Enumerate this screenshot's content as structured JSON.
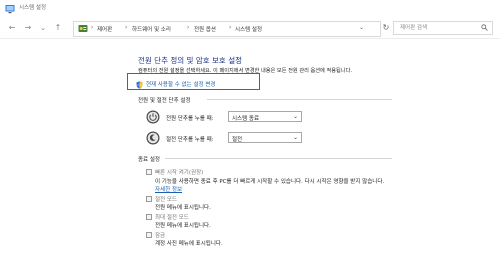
{
  "window": {
    "title": "시스템 설정"
  },
  "nav": {
    "back": "←",
    "forward": "→",
    "dropdown": "⌄",
    "up": "↑",
    "breadcrumb": [
      "제어판",
      "하드웨어 및 소리",
      "전원 옵션",
      "시스템 설정"
    ],
    "separator": "›",
    "refresh": "↻",
    "search_placeholder": "제어판 검색"
  },
  "main": {
    "heading": "전원 단추 정의 및 암호 보호 설정",
    "description": "컴퓨터의 전원 설정을 선택하세요. 이 페이지에서 변경한 내용은 모든 전원 관리 옵션에 적용됩니다.",
    "change_link": "현재 사용할 수 없는 설정 변경",
    "power_section": {
      "title": "전원 및 절전 단추 설정",
      "rows": [
        {
          "label": "전원 단추를 누를 때:",
          "value": "시스템 종료",
          "icon": "power-icon"
        },
        {
          "label": "절전 단추를 누를 때:",
          "value": "절전",
          "icon": "sleep-icon"
        }
      ]
    },
    "shutdown_section": {
      "title": "종료 설정",
      "fast_startup": {
        "label": "빠른 시작 켜기(권장)",
        "desc": "이 기능을 사용하면 종료 후 PC를 더 빠르게 시작할 수 있습니다. 다시 시작은 영향을 받지 않습니다.",
        "link": "자세한 정보"
      },
      "sleep": {
        "label": "절전 모드",
        "desc": "전원 메뉴에 표시됩니다."
      },
      "hibernate": {
        "label": "최대 절전 모드",
        "desc": "전원 메뉴에 표시됩니다."
      },
      "lock": {
        "label": "잠금",
        "desc": "계정 사진 메뉴에 표시됩니다."
      }
    }
  },
  "colors": {
    "heading": "#1e3287",
    "link": "#1a5fb4",
    "highlight_box": "#e8252a"
  }
}
